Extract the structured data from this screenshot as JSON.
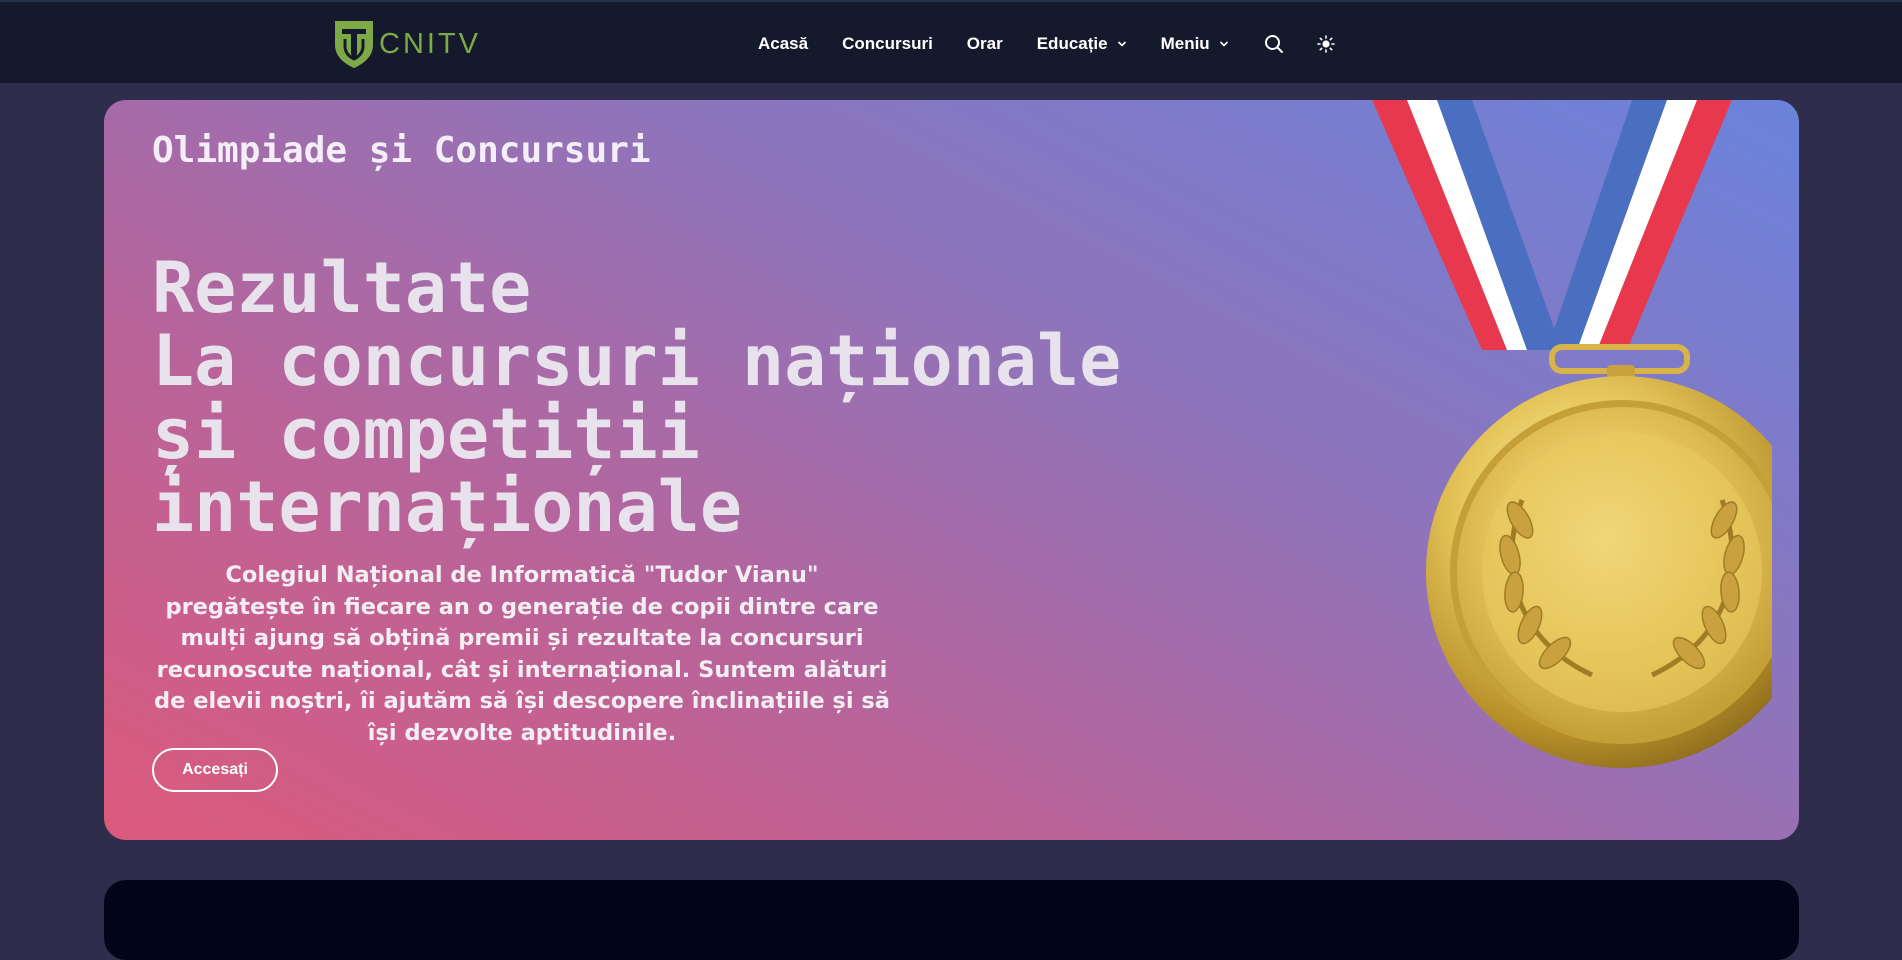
{
  "header": {
    "logo_text": "CNITV",
    "nav": {
      "acasa": "Acasă",
      "concursuri": "Concursuri",
      "orar": "Orar",
      "educatie": "Educație",
      "meniu": "Meniu"
    },
    "icons": [
      "search-icon",
      "sun-icon",
      "chevron-down-icon"
    ]
  },
  "hero": {
    "kicker": "Olimpiade și Concursuri",
    "title_lines": [
      "Rezultate",
      "La concursuri naționale",
      "și competiții",
      "internaționale"
    ],
    "description": "Colegiul Național de Informatică \"Tudor Vianu\" pregătește în fiecare an o generație de copii dintre care mulți ajung să obțină premii și rezultate la concursuri recunoscute național, cât și internațional. Suntem alături de elevii noștri, îi ajutăm să își descopere înclinațiile și să își dezvolte aptitudinile.",
    "button": "Accesați"
  },
  "colors": {
    "header_bg": "#141a2b",
    "page_bg": "#2f2d4c",
    "logo_green": "#7daa47",
    "gradient_start": "#dc5a7c",
    "gradient_end": "#6a83dc",
    "medal_gold": "#d9b84a"
  }
}
